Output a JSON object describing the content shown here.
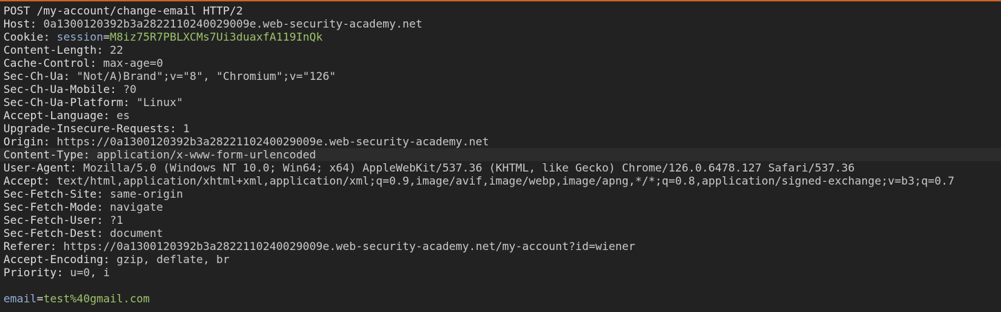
{
  "request_line": "POST /my-account/change-email HTTP/2",
  "headers": [
    {
      "name": "Host",
      "value": "0a1300120392b3a2822110240029009e.web-security-academy.net"
    },
    {
      "name": "Cookie",
      "cookie_name": "session",
      "cookie_value": "M8iz75R7PBLXCMs7Ui3duaxfA119InQk"
    },
    {
      "name": "Content-Length",
      "value": "22"
    },
    {
      "name": "Cache-Control",
      "value": "max-age=0"
    },
    {
      "name": "Sec-Ch-Ua",
      "value": "\"Not/A)Brand\";v=\"8\", \"Chromium\";v=\"126\""
    },
    {
      "name": "Sec-Ch-Ua-Mobile",
      "value": "?0"
    },
    {
      "name": "Sec-Ch-Ua-Platform",
      "value": "\"Linux\""
    },
    {
      "name": "Accept-Language",
      "value": "es"
    },
    {
      "name": "Upgrade-Insecure-Requests",
      "value": "1"
    },
    {
      "name": "Origin",
      "value": "https://0a1300120392b3a2822110240029009e.web-security-academy.net"
    },
    {
      "name": "Content-Type",
      "value": "application/x-www-form-urlencoded"
    },
    {
      "name": "User-Agent",
      "value": "Mozilla/5.0 (Windows NT 10.0; Win64; x64) AppleWebKit/537.36 (KHTML, like Gecko) Chrome/126.0.6478.127 Safari/537.36"
    },
    {
      "name": "Accept",
      "value": "text/html,application/xhtml+xml,application/xml;q=0.9,image/avif,image/webp,image/apng,*/*;q=0.8,application/signed-exchange;v=b3;q=0.7"
    },
    {
      "name": "Sec-Fetch-Site",
      "value": "same-origin"
    },
    {
      "name": "Sec-Fetch-Mode",
      "value": "navigate"
    },
    {
      "name": "Sec-Fetch-User",
      "value": "?1"
    },
    {
      "name": "Sec-Fetch-Dest",
      "value": "document"
    },
    {
      "name": "Referer",
      "value": "https://0a1300120392b3a2822110240029009e.web-security-academy.net/my-account?id=wiener"
    },
    {
      "name": "Accept-Encoding",
      "value": "gzip, deflate, br"
    },
    {
      "name": "Priority",
      "value": "u=0, i"
    }
  ],
  "body": {
    "param_name": "email",
    "param_value": "test%40gmail.com"
  },
  "colors": {
    "background": "#222222",
    "highlight_line": "#2c2c2c",
    "cookie_name": "#94aed4",
    "cookie_value": "#9ec26b",
    "top_border": "#d0641f"
  }
}
